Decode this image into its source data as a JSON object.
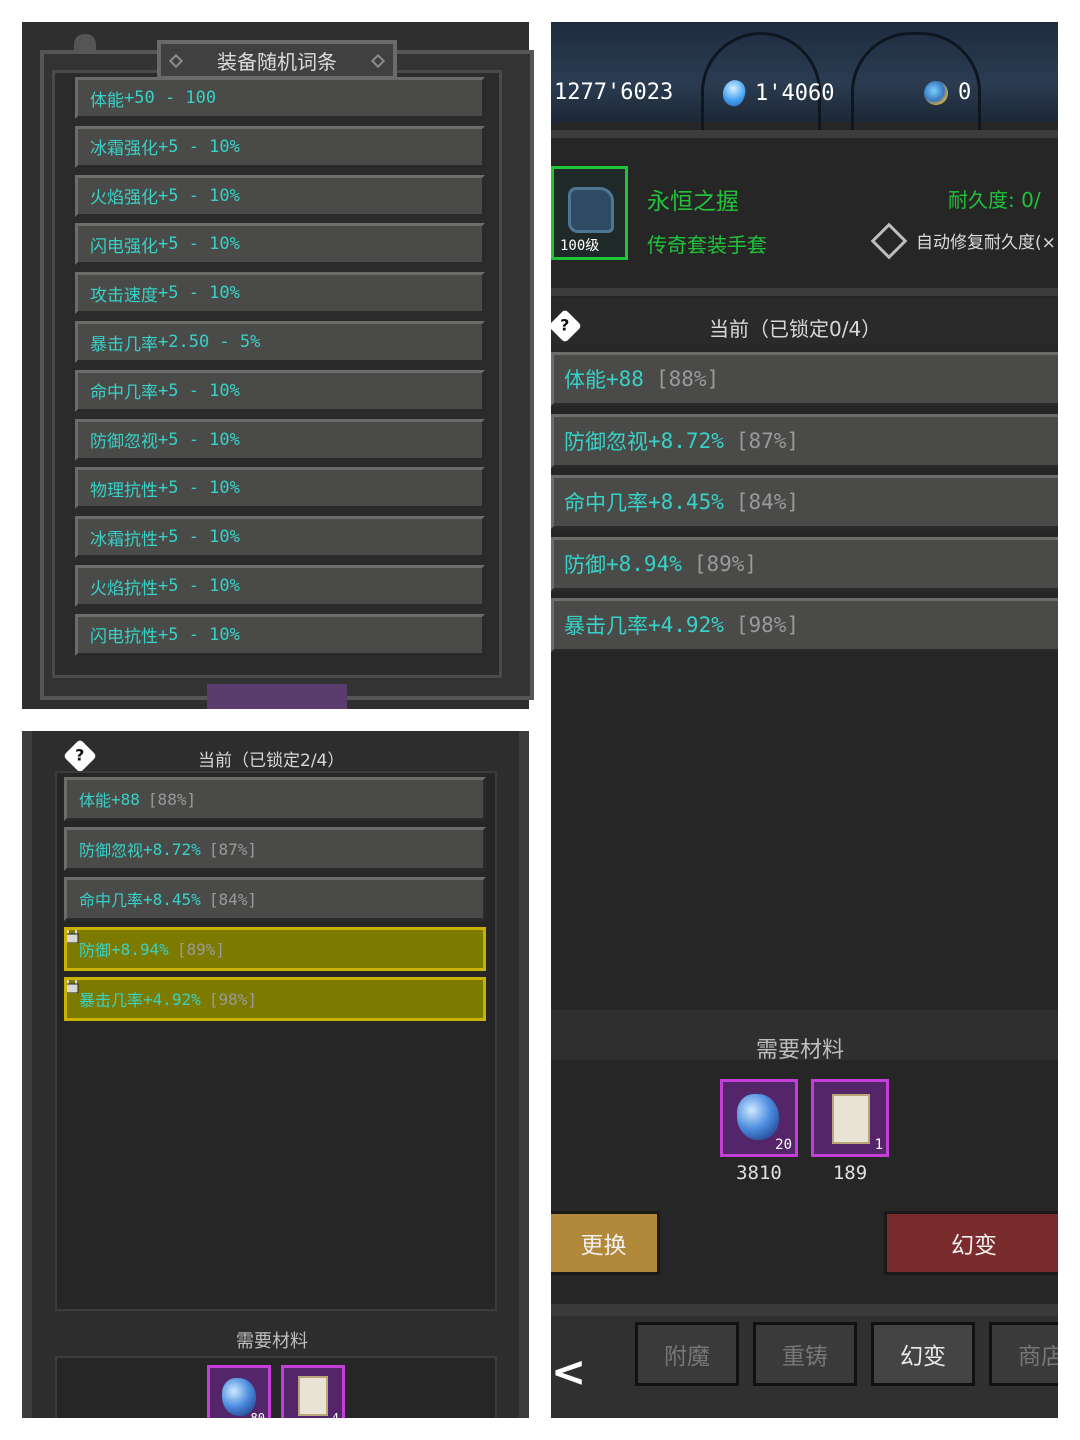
{
  "panel_affixes": {
    "title": "装备随机词条",
    "rows": [
      {
        "name": "体能",
        "range": "+50 - 100"
      },
      {
        "name": "冰霜强化",
        "range": "+5 - 10%"
      },
      {
        "name": "火焰强化",
        "range": "+5 - 10%"
      },
      {
        "name": "闪电强化",
        "range": "+5 - 10%"
      },
      {
        "name": "攻击速度",
        "range": "+5 - 10%"
      },
      {
        "name": "暴击几率",
        "range": "+2.50 - 5%"
      },
      {
        "name": "命中几率",
        "range": "+5 - 10%"
      },
      {
        "name": "防御忽视",
        "range": "+5 - 10%"
      },
      {
        "name": "物理抗性",
        "range": "+5 - 10%"
      },
      {
        "name": "冰霜抗性",
        "range": "+5 - 10%"
      },
      {
        "name": "火焰抗性",
        "range": "+5 - 10%"
      },
      {
        "name": "闪电抗性",
        "range": "+5 - 10%"
      }
    ]
  },
  "panel_locked": {
    "help_icon": "question-icon",
    "current_title": "当前（已锁定2/4）",
    "rows": [
      {
        "name": "体能",
        "value": "+88",
        "pct": "[88%]",
        "locked": false
      },
      {
        "name": "防御忽视",
        "value": "+8.72%",
        "pct": "[87%]",
        "locked": false
      },
      {
        "name": "命中几率",
        "value": "+8.45%",
        "pct": "[84%]",
        "locked": false
      },
      {
        "name": "防御",
        "value": "+8.94%",
        "pct": "[89%]",
        "locked": true
      },
      {
        "name": "暴击几率",
        "value": "+4.92%",
        "pct": "[98%]",
        "locked": true
      }
    ],
    "materials_title": "需要材料",
    "materials": [
      {
        "icon": "crystal-gem-icon",
        "count": "80"
      },
      {
        "icon": "scroll-icon",
        "count": "4"
      }
    ]
  },
  "panel_detail": {
    "resources": {
      "gold": "1277'6023",
      "gems": "1'4060",
      "coins": "0"
    },
    "item": {
      "level": "100级",
      "name": "永恒之握",
      "type": "传奇套装手套",
      "durability_label": "耐久度: 0/",
      "auto_repair_label": "自动修复耐久度(×"
    },
    "current_title": "当前（已锁定0/4）",
    "rows": [
      {
        "name": "体能",
        "value": "+88",
        "pct": "[88%]"
      },
      {
        "name": "防御忽视",
        "value": "+8.72%",
        "pct": "[87%]"
      },
      {
        "name": "命中几率",
        "value": "+8.45%",
        "pct": "[84%]"
      },
      {
        "name": "防御",
        "value": "+8.94%",
        "pct": "[89%]"
      },
      {
        "name": "暴击几率",
        "value": "+4.92%",
        "pct": "[98%]"
      }
    ],
    "materials_title": "需要材料",
    "materials": [
      {
        "icon": "crystal-gem-icon",
        "count": "20",
        "owned": "3810"
      },
      {
        "icon": "scroll-icon",
        "count": "1",
        "owned": "189"
      }
    ],
    "buttons": {
      "replace": "更换",
      "transmog": "幻变"
    },
    "tabs": [
      "附魔",
      "重铸",
      "幻变",
      "商店"
    ],
    "active_tab": "幻变",
    "colors": {
      "affix_text": "#37d2c8",
      "legendary_green": "#20c33a",
      "locked_row": "#7d7a00",
      "material_border": "#c33fd8",
      "transmog_button": "#7a2b2b",
      "replace_button": "#b2893a"
    }
  }
}
